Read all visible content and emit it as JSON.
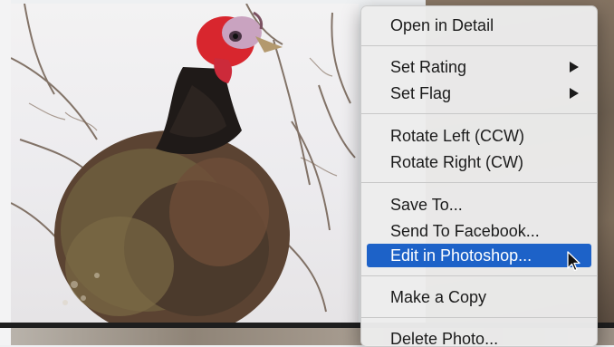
{
  "context_menu": {
    "items": [
      {
        "label": "Open in Detail"
      },
      {
        "label": "Set Rating",
        "submenu_indicator": "submenu-arrow-icon"
      },
      {
        "label": "Set Flag",
        "submenu_indicator": "submenu-arrow-icon"
      },
      {
        "label": "Rotate Left (CCW)"
      },
      {
        "label": "Rotate Right (CW)"
      },
      {
        "label": "Save To..."
      },
      {
        "label": "Send To Facebook..."
      },
      {
        "label": "Edit in Photoshop...",
        "state": "highlighted"
      },
      {
        "label": "Make a Copy"
      },
      {
        "label": "Delete Photo..."
      }
    ],
    "highlight_color": "#1d62c8"
  },
  "photo": {
    "subject_icon": "turkey-photo",
    "background_color": "#f0eff1"
  },
  "cursor": {
    "icon": "arrow-cursor-icon"
  }
}
